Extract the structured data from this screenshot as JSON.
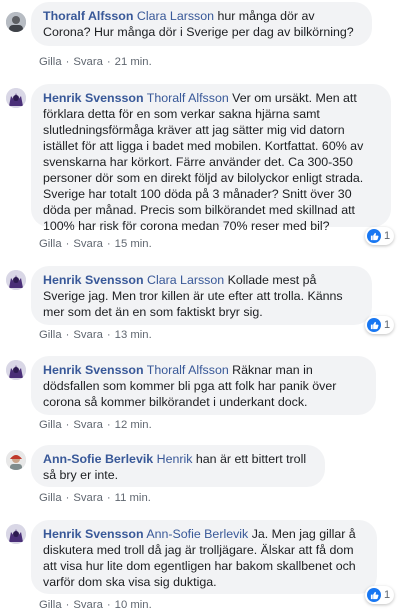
{
  "actions": {
    "like": "Gilla",
    "reply": "Svara",
    "separator": "·"
  },
  "comments": [
    {
      "author": "Thoralf Alfsson",
      "mention": "Clara Larsson",
      "text": " hur många dör av Corona? Hur många dör i Sverige per dag av bilkörning?",
      "time": "21 min."
    },
    {
      "author": "Henrik Svensson",
      "mention": "Thoralf Alfsson",
      "text": " Ver om ursäkt. Men att förklara detta för en som verkar sakna hjärna samt slutledningsförmåga kräver att jag sätter mig vid datorn istället för att ligga i badet med mobilen. Kortfattat. 60% av svenskarna har körkort. Färre använder det. Ca 300-350 personer dör som en direkt följd av bilolyckor enligt strada. Sverige har totalt 100 döda på 3 månader? Snitt över 30 döda per månad. Precis som bilkörandet med skillnad att 100% har risk för corona medan 70% reser med bil?",
      "time": "15 min.",
      "reactions": "1"
    },
    {
      "author": "Henrik Svensson",
      "mention": "Clara Larsson",
      "text": " Kollade mest på Sverige jag. Men tror killen är ute efter att trolla. Känns mer som det än en som faktiskt bryr sig.",
      "time": "13 min.",
      "reactions": "1"
    },
    {
      "author": "Henrik Svensson",
      "mention": "Thoralf Alfsson",
      "text": " Räknar man in dödsfallen som kommer bli pga att folk har panik över corona så kommer bilkörandet i underkant dock.",
      "time": "12 min."
    },
    {
      "author": "Ann-Sofie Berlevik",
      "mention": "Henrik",
      "text": " han är ett bittert troll så bry er inte.",
      "time": "11 min."
    },
    {
      "author": "Henrik Svensson",
      "mention": "Ann-Sofie Berlevik",
      "text": " Ja. Men jag gillar å diskutera med troll då jag är trolljägare. Älskar att få dom att visa hur lite dom egentligen har bakom skallbenet och varför dom ska visa sig duktiga.",
      "time": "10 min.",
      "reactions": "1"
    }
  ]
}
